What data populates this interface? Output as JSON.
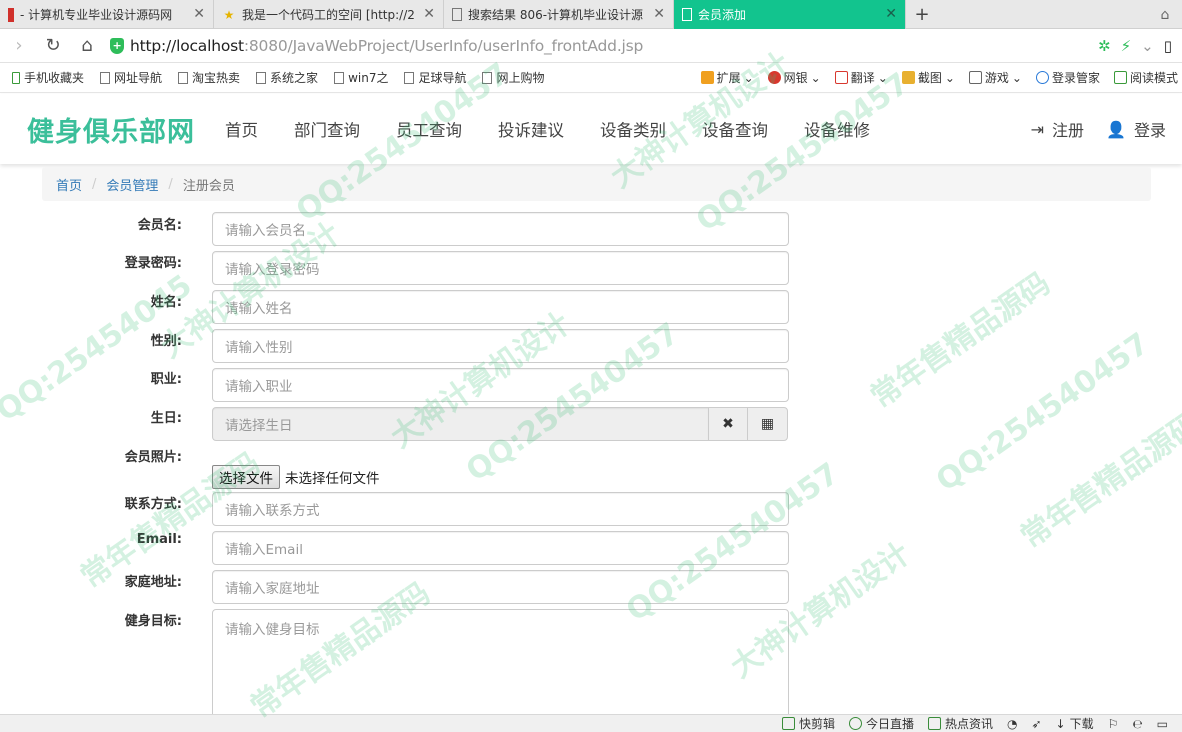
{
  "browser": {
    "tabs": [
      {
        "title": "- 计算机专业毕业设计源码网",
        "active": false
      },
      {
        "title": "我是一个代码工的空间 [http://2",
        "active": false
      },
      {
        "title": "搜索结果 806-计算机毕业设计源",
        "active": false
      },
      {
        "title": "会员添加",
        "active": true
      }
    ],
    "new_tab": "+",
    "url_host": "http://localhost",
    "url_path": ":8080/JavaWebProject/UserInfo/userInfo_frontAdd.jsp",
    "bookmarks": [
      "手机收藏夹",
      "网址导航",
      "淘宝热卖",
      "系统之家",
      "win7之",
      "足球导航",
      "网上购物"
    ],
    "tools": [
      "扩展",
      "网银",
      "翻译",
      "截图",
      "游戏",
      "登录管家",
      "阅读模式"
    ],
    "status_items": [
      "快剪辑",
      "今日直播",
      "热点资讯",
      "下载"
    ]
  },
  "site": {
    "brand": "健身俱乐部网",
    "menu": [
      "首页",
      "部门查询",
      "员工查询",
      "投诉建议",
      "设备类别",
      "设备查询",
      "设备维修"
    ],
    "register": "注册",
    "login": "登录"
  },
  "breadcrumb": {
    "home": "首页",
    "section": "会员管理",
    "current": "注册会员"
  },
  "form": {
    "username": {
      "label": "会员名:",
      "placeholder": "请输入会员名"
    },
    "password": {
      "label": "登录密码:",
      "placeholder": "请输入登录密码"
    },
    "name": {
      "label": "姓名:",
      "placeholder": "请输入姓名"
    },
    "gender": {
      "label": "性别:",
      "placeholder": "请输入性别"
    },
    "job": {
      "label": "职业:",
      "placeholder": "请输入职业"
    },
    "birthday": {
      "label": "生日:",
      "placeholder": "请选择生日"
    },
    "photo": {
      "label": "会员照片:",
      "button": "选择文件",
      "status": "未选择任何文件"
    },
    "contact": {
      "label": "联系方式:",
      "placeholder": "请输入联系方式"
    },
    "email": {
      "label": "Email:",
      "placeholder": "请输入Email"
    },
    "address": {
      "label": "家庭地址:",
      "placeholder": "请输入家庭地址"
    },
    "goal": {
      "label": "健身目标:",
      "placeholder": "请输入健身目标"
    }
  },
  "watermark": [
    "QQ:25454045",
    "大神计算机设计",
    "常年售精品源码",
    "QQ:254540457",
    "大神计算机设计",
    "常年售精品源码",
    "QQ:254540457",
    "大神计算机设计",
    "QQ:254540457",
    "常年售精品源码",
    "QQ:254540457",
    "大神计算机设计",
    "常年售精品源码",
    "QQ:254540457"
  ],
  "colors": {
    "brand": "#3bbf9a",
    "active_tab": "#12c48e",
    "link": "#337ab7"
  }
}
